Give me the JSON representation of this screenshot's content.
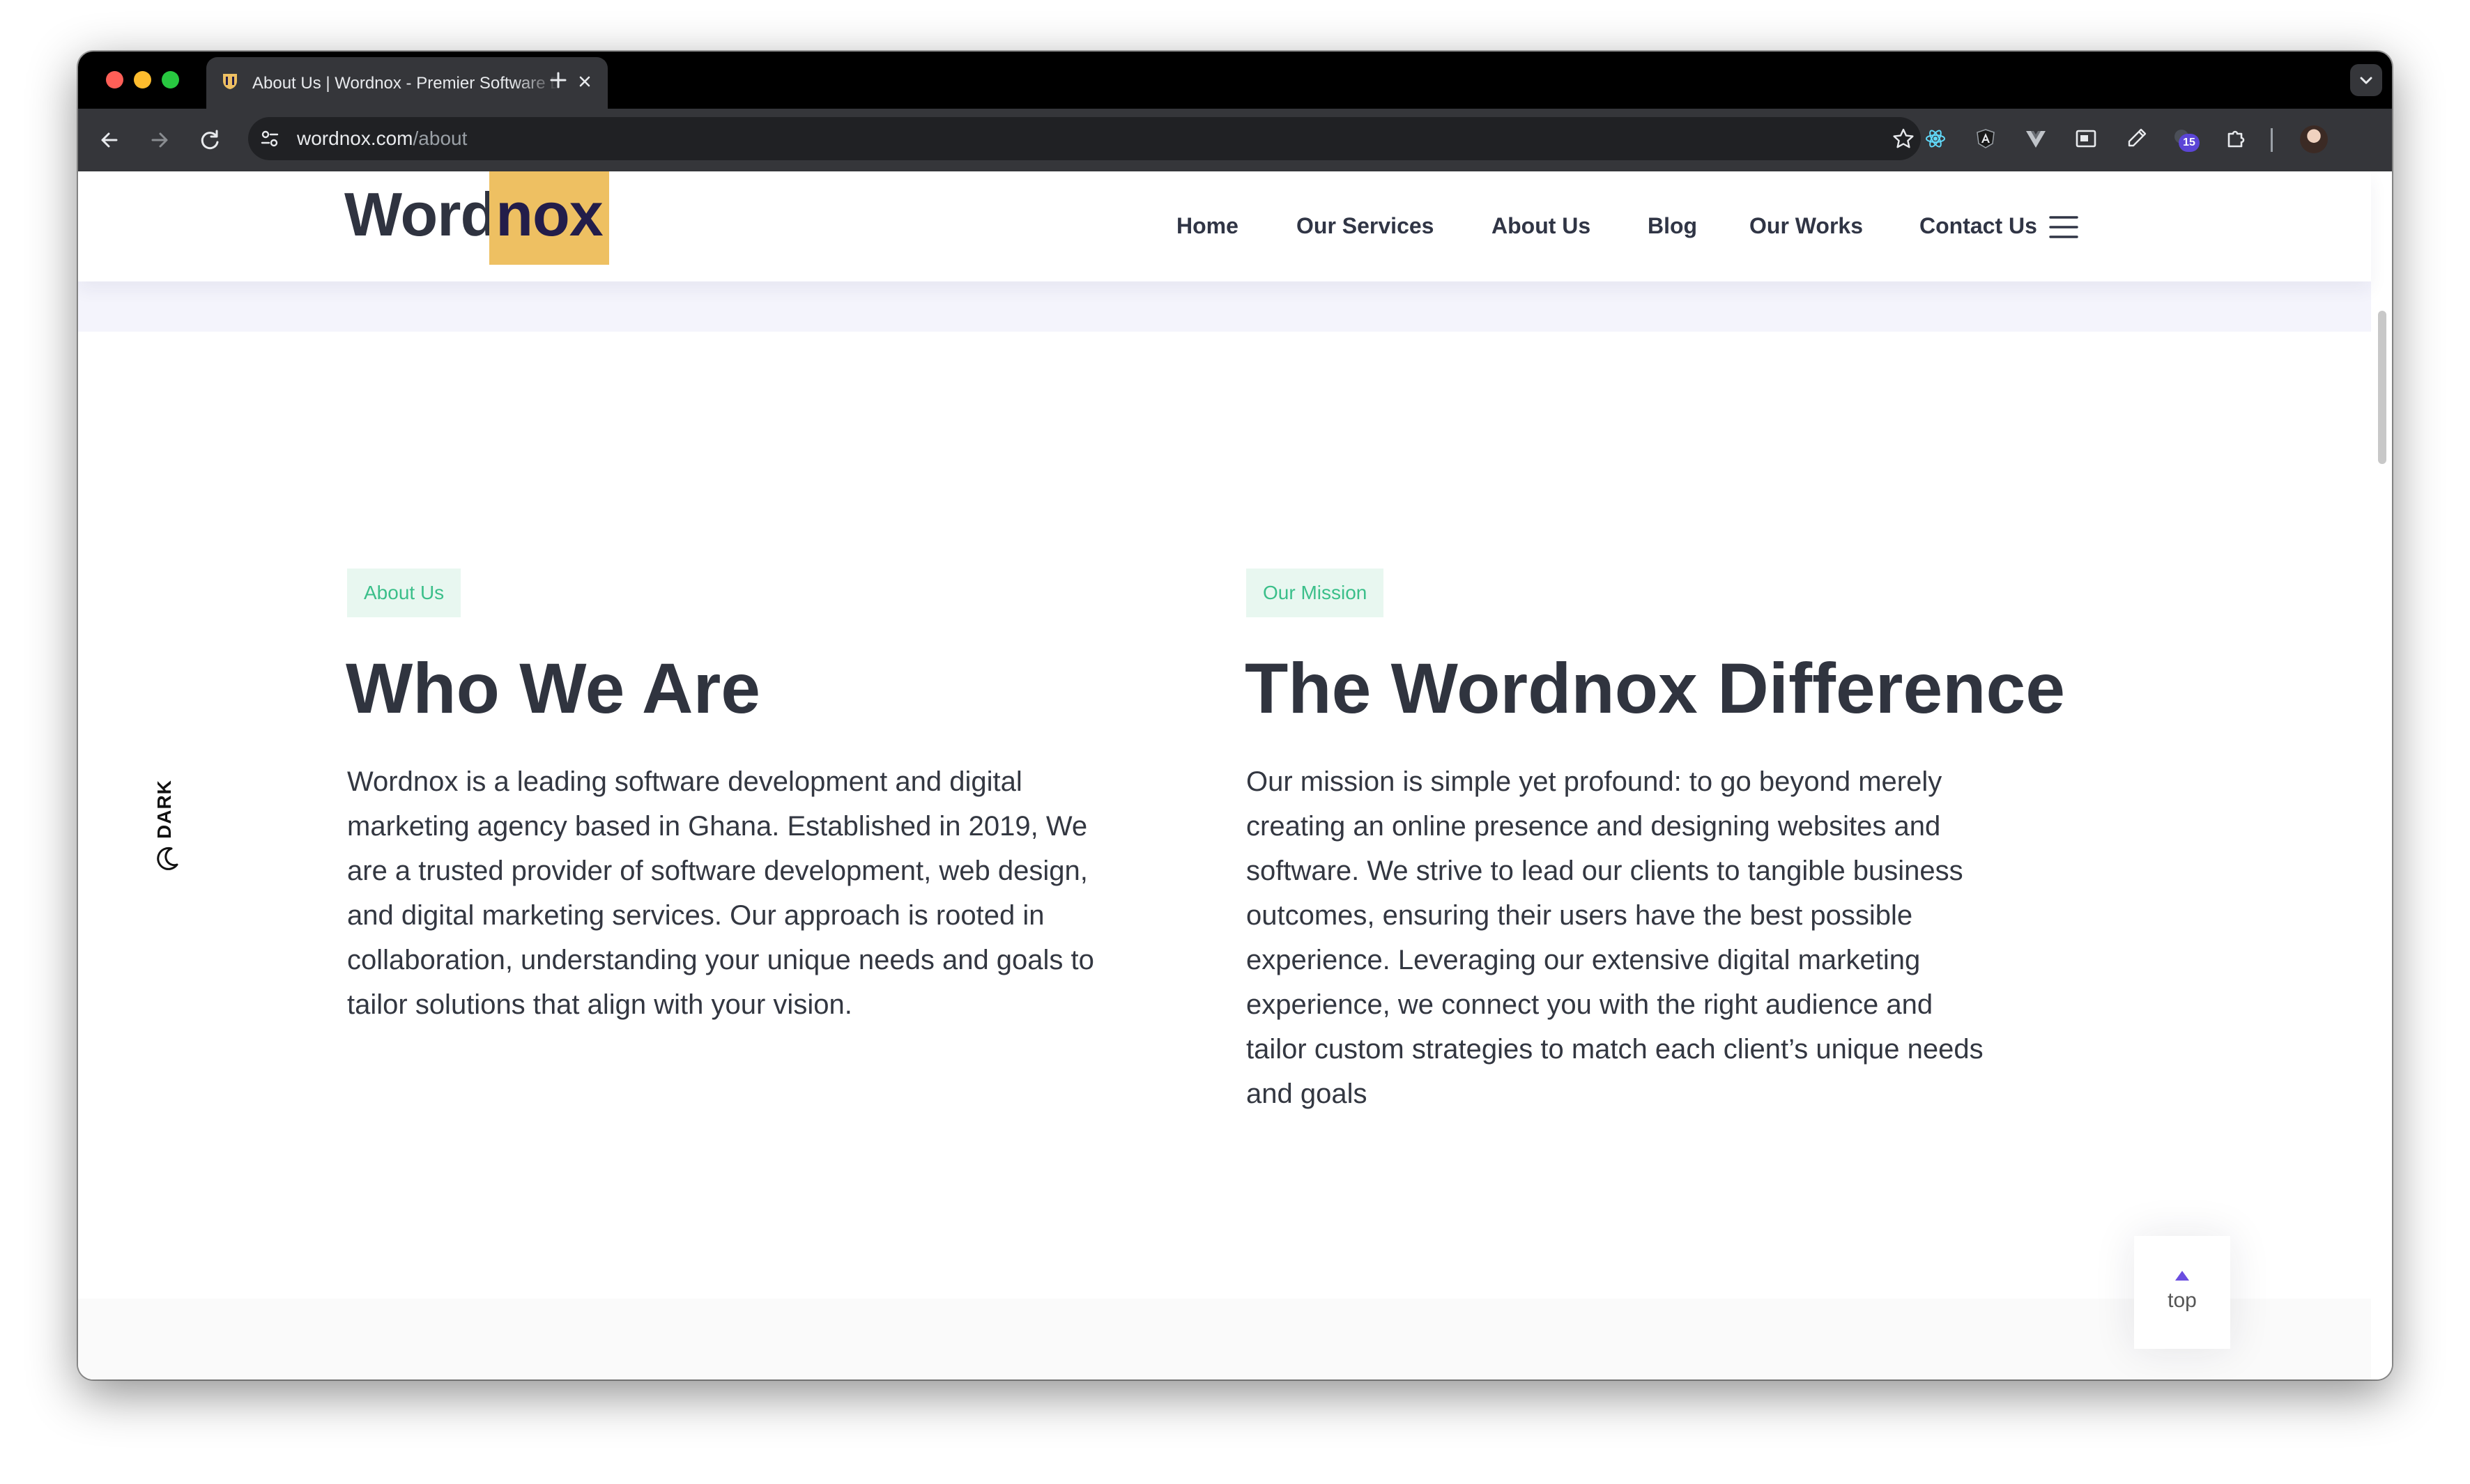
{
  "browser": {
    "tab_title": "About Us | Wordnox - Premier Software Development Agency",
    "url_host": "wordnox.com",
    "url_path": "/about",
    "extension_badge": "15",
    "colors": {
      "tab_strip": "#000000",
      "toolbar": "#35363a",
      "omnibox": "#202124"
    }
  },
  "header": {
    "logo_word": "Word",
    "logo_nox": "nox",
    "nav": [
      "Home",
      "Our Services",
      "About Us",
      "Blog",
      "Our Works",
      "Contact Us"
    ],
    "menu_icon": "hamburger-icon"
  },
  "theme_toggle": {
    "label": "DARK",
    "icon": "moon-icon"
  },
  "about": {
    "tag": "About Us",
    "heading": "Who We Are",
    "body": "Wordnox is a leading software development and digital marketing agency based in Ghana. Established in 2019, We are a trusted provider of software development, web design, and digital marketing services.  Our approach is rooted in collaboration, understanding your unique needs and goals to tailor solutions that align with your vision."
  },
  "mission": {
    "tag": "Our Mission",
    "heading": "The Wordnox Difference",
    "body": "Our mission is simple yet profound: to go beyond merely creating an online presence and designing websites and software. We strive to lead our clients to tangible business outcomes, ensuring their users have the best possible experience. Leveraging our extensive digital marketing experience, we connect you with the right audience and tailor custom strategies to match each client’s unique needs and goals"
  },
  "back_to_top": {
    "label": "top"
  },
  "colors": {
    "logo_highlight": "#eec062",
    "tag_bg": "#e8f7f0",
    "tag_text": "#3bbf8a",
    "heading": "#30343f",
    "accent_arrow": "#6a4de0"
  }
}
